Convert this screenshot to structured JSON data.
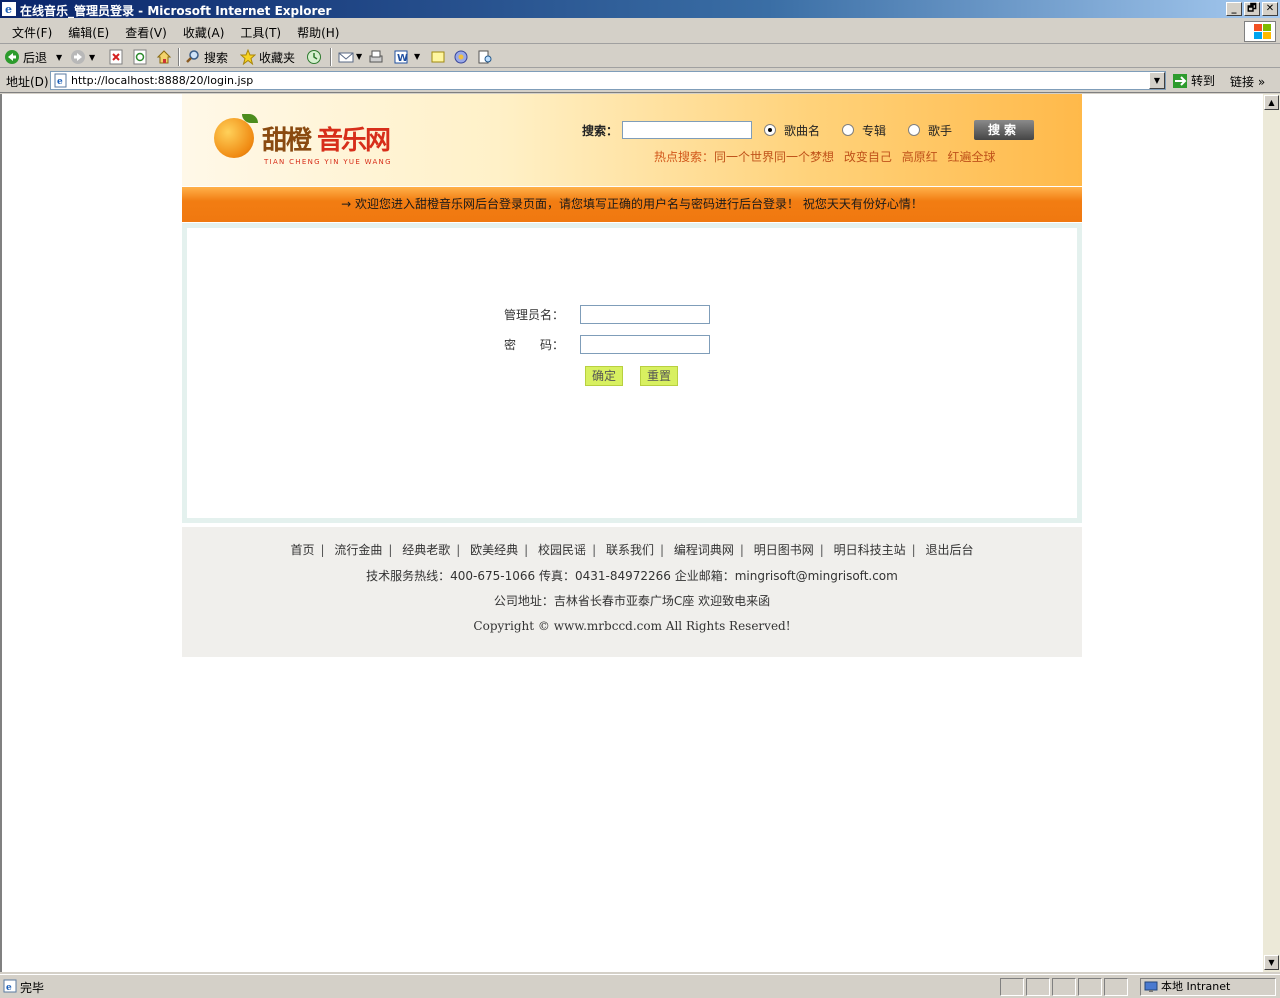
{
  "window": {
    "title": "在线音乐_管理员登录 - Microsoft Internet Explorer",
    "buttons": [
      "_",
      "🗗",
      "✕"
    ]
  },
  "menu": [
    "文件(F)",
    "编辑(E)",
    "查看(V)",
    "收藏(A)",
    "工具(T)",
    "帮助(H)"
  ],
  "toolbar": {
    "back": "后退",
    "search": "搜索",
    "favorites": "收藏夹"
  },
  "address": {
    "label": "地址(D)",
    "url": "http://localhost:8888/20/login.jsp",
    "go": "转到",
    "links": "链接"
  },
  "header": {
    "logo_cn_a": "甜橙",
    "logo_cn_b": "音乐网",
    "logo_pinyin": "TIAN CHENG YIN YUE WANG",
    "search_label": "搜索：",
    "search_value": "",
    "radio_song": "歌曲名",
    "radio_album": "专辑",
    "radio_singer": "歌手",
    "search_button": "搜索",
    "hot_label": "热点搜索：",
    "hot_items": [
      "同一个世界同一个梦想",
      "改变自己",
      "高原红",
      "红遍全球"
    ]
  },
  "welcome": "→ 欢迎您进入甜橙音乐网后台登录页面，请您填写正确的用户名与密码进行后台登录！  祝您天天有份好心情！",
  "login": {
    "user_label": "管理员名：",
    "pass_label": "密　　码：",
    "user_value": "",
    "pass_value": "",
    "ok": "确定",
    "reset": "重置"
  },
  "footer": {
    "nav": [
      "首页",
      "流行金曲",
      "经典老歌",
      "欧美经典",
      "校园民谣",
      "联系我们",
      "编程词典网",
      "明日图书网",
      "明日科技主站",
      "退出后台"
    ],
    "contact": "技术服务热线：400-675-1066 传真：0431-84972266 企业邮箱：mingrisoft@mingrisoft.com",
    "address": "公司地址：吉林省长春市亚泰广场C座 欢迎致电来函",
    "copyright": "Copyright © www.mrbccd.com All Rights Reserved!"
  },
  "status": {
    "text": "完毕",
    "zone": "本地 Intranet"
  }
}
